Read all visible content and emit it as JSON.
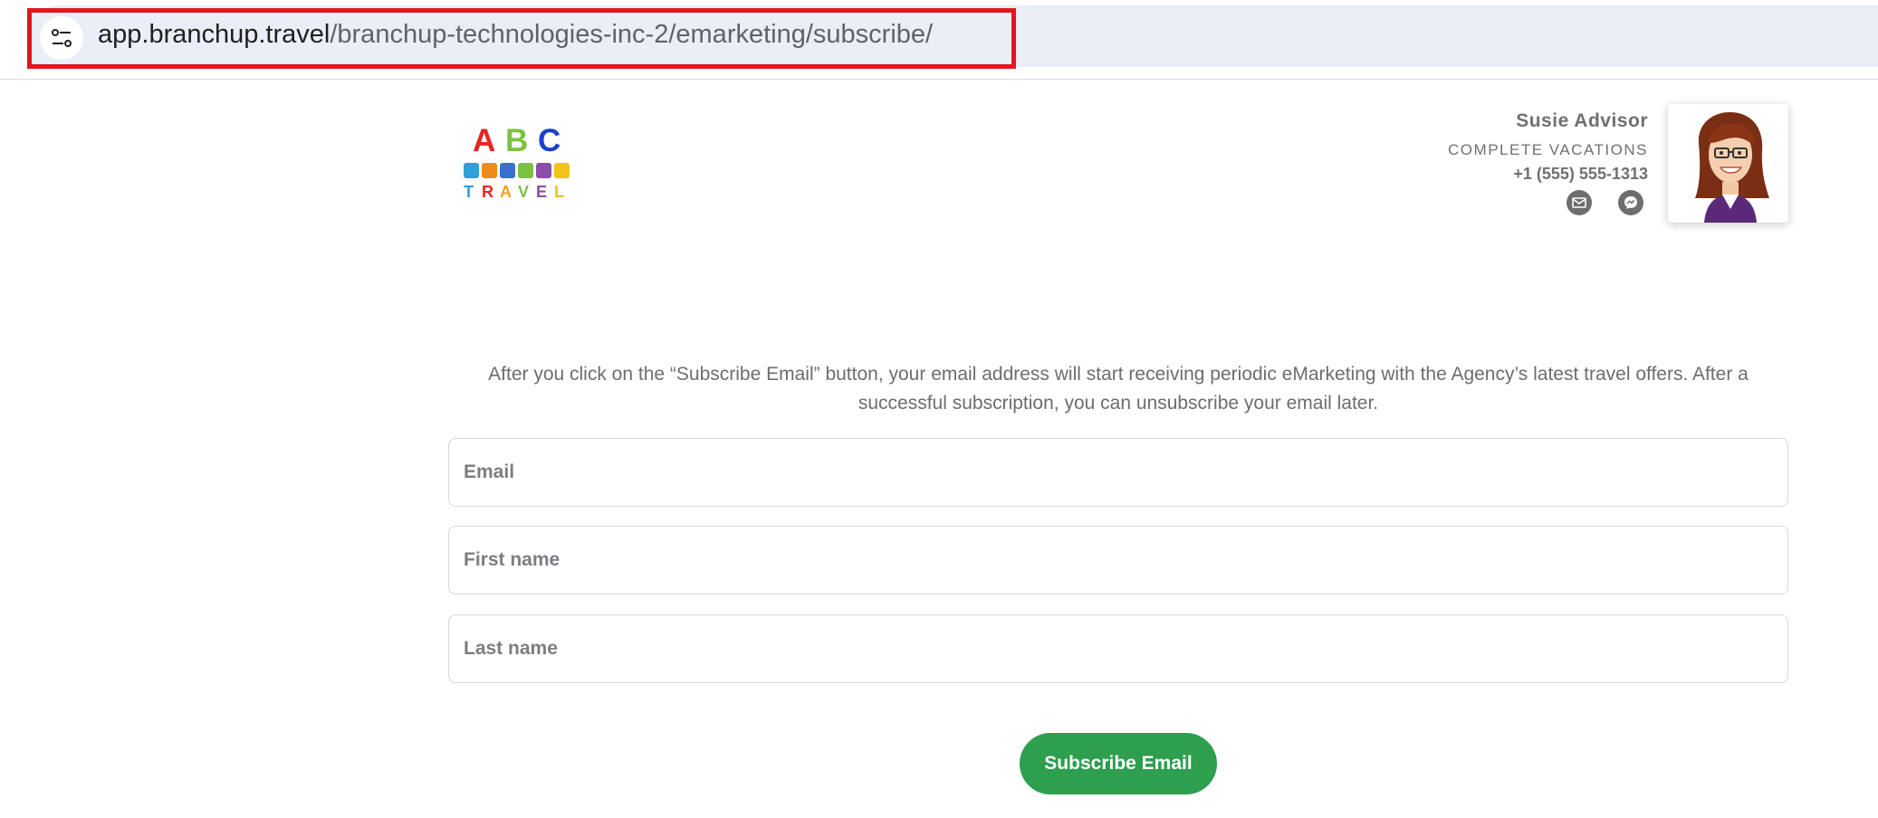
{
  "browser": {
    "url_host": "app.branchup.travel",
    "url_path": "/branchup-technologies-inc-2/emarketing/subscribe/",
    "site_info_icon": "tune-icon",
    "highlight_color": "#e3161f"
  },
  "logo": {
    "letters": [
      "A",
      "B",
      "C"
    ],
    "letter_colors": [
      "#e8251f",
      "#7cc242",
      "#1a3fd1"
    ],
    "word": [
      "T",
      "R",
      "A",
      "V",
      "E",
      "L"
    ],
    "word_colors": [
      "#2f9fd8",
      "#e8251f",
      "#f2a21a",
      "#7cc242",
      "#8a4fa6",
      "#f2c21a"
    ],
    "icon_colors": [
      "#2f9fd8",
      "#f08a1a",
      "#3a6fd0",
      "#7cc242",
      "#8a4fa6",
      "#f2c21a"
    ]
  },
  "agent": {
    "name": "Susie Advisor",
    "agency": "COMPLETE VACATIONS",
    "phone": "+1 (555) 555-1313",
    "icons": [
      "email-icon",
      "messenger-icon"
    ]
  },
  "form": {
    "intro": "After you click on the “Subscribe Email” button, your email address will start receiving periodic eMarketing with the Agency’s latest travel offers. After a successful subscription, you can unsubscribe your email later.",
    "email_placeholder": "Email",
    "first_name_placeholder": "First name",
    "last_name_placeholder": "Last name",
    "submit_label": "Subscribe Email",
    "submit_color": "#2e9e4f"
  }
}
